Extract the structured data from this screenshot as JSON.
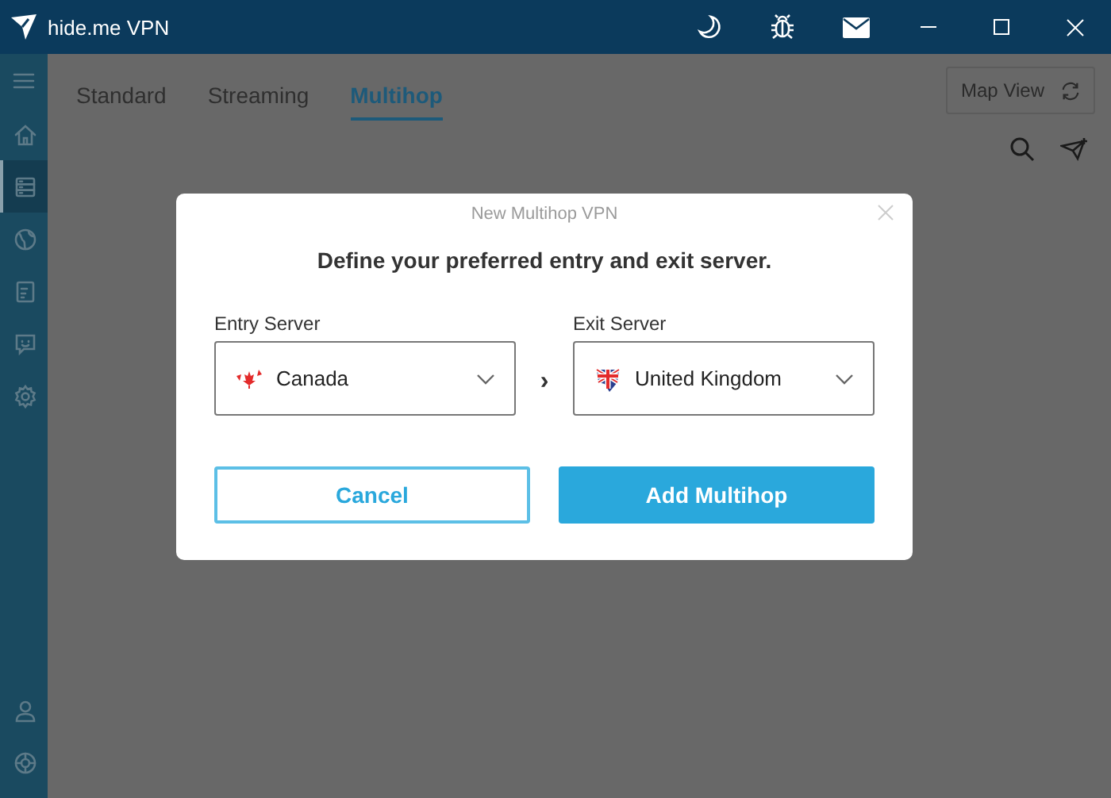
{
  "window": {
    "title": "hide.me VPN"
  },
  "sidebar": {
    "items": [
      {
        "kind": "home",
        "selected": false
      },
      {
        "kind": "servers",
        "selected": true
      },
      {
        "kind": "globe",
        "selected": false
      },
      {
        "kind": "document",
        "selected": false
      },
      {
        "kind": "chat",
        "selected": false
      },
      {
        "kind": "settings",
        "selected": false
      }
    ],
    "bottom_items": [
      {
        "kind": "user",
        "selected": false
      },
      {
        "kind": "help",
        "selected": false
      }
    ]
  },
  "tabs": [
    {
      "label": "Standard",
      "selected": false
    },
    {
      "label": "Streaming",
      "selected": false
    },
    {
      "label": "Multihop",
      "selected": true
    }
  ],
  "map_view_button": {
    "label": "Map View"
  },
  "dialog": {
    "title": "New Multihop VPN",
    "heading": "Define your preferred entry and exit server.",
    "entry": {
      "label": "Entry Server",
      "value": "Canada",
      "kind": "ca"
    },
    "separator": "›",
    "exit": {
      "label": "Exit Server",
      "value": "United Kingdom",
      "kind": "gb"
    },
    "buttons": [
      {
        "label": "Cancel",
        "kind": "secondary"
      },
      {
        "label": "Add Multihop",
        "kind": "primary"
      }
    ]
  }
}
